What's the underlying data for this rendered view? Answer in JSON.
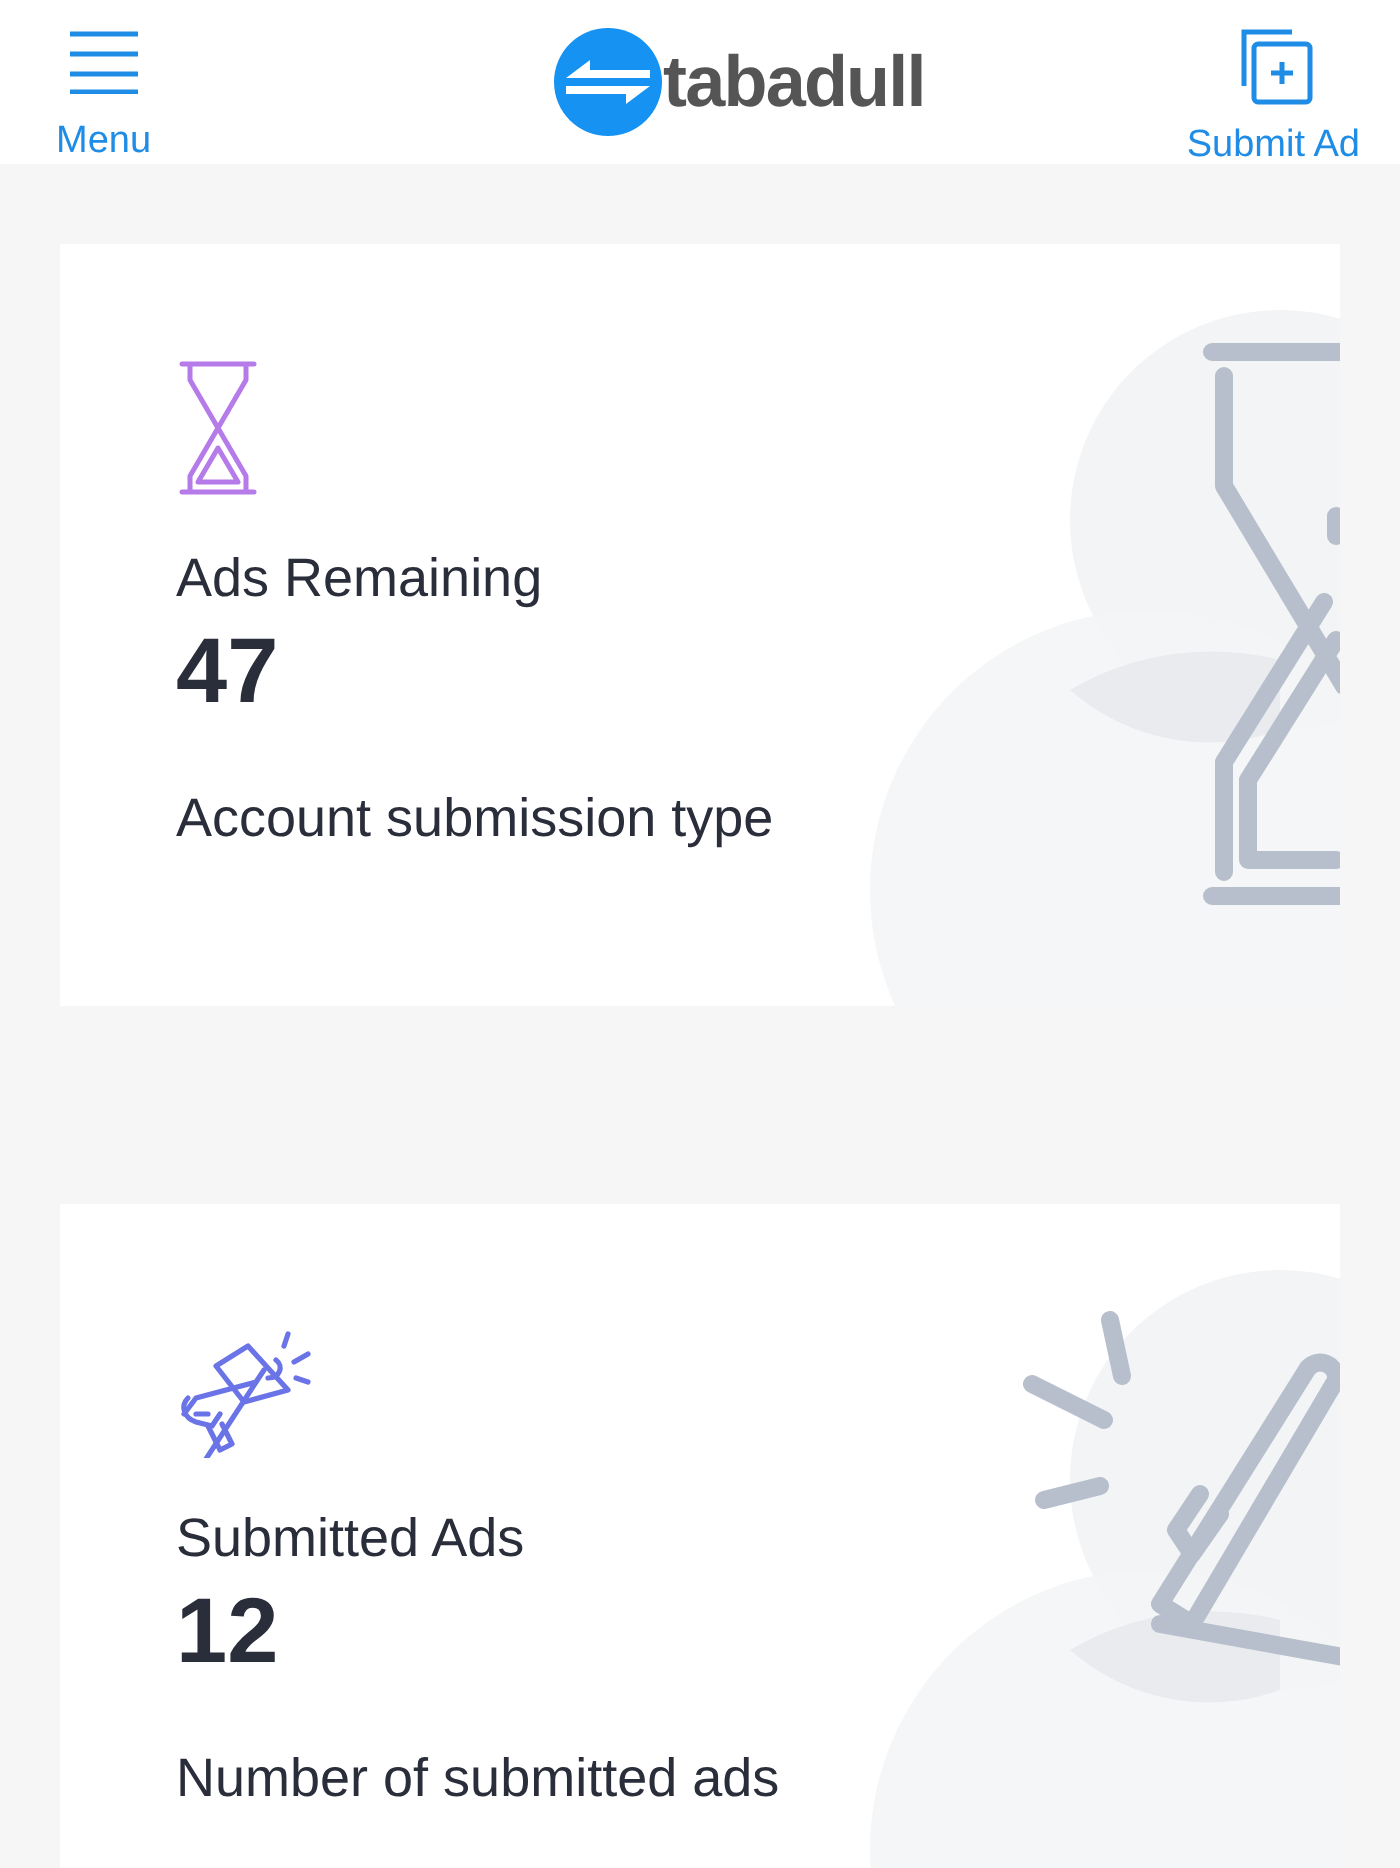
{
  "header": {
    "menu_label": "Menu",
    "logo_text": "tabadull",
    "submit_label": "Submit Ad"
  },
  "cards": [
    {
      "kind": "hourglass",
      "title": "Ads Remaining",
      "value": "47",
      "caption": "Account submission type"
    },
    {
      "kind": "megaphone",
      "title": "Submitted Ads",
      "value": "12",
      "caption": "Number of submitted ads"
    }
  ]
}
